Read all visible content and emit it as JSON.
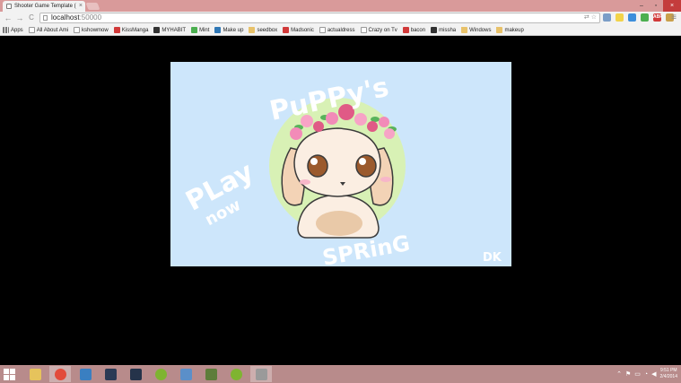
{
  "browser": {
    "tab_title": "Shooter Game Template (",
    "tab_close": "×",
    "url_host": "localhost",
    "url_port": ":50000",
    "back_glyph": "←",
    "forward_glyph": "→",
    "reload_glyph": "C",
    "star_glyph": "☆",
    "menu_glyph": "≡",
    "window_minimize": "–",
    "window_maximize": "▫",
    "window_close": "×",
    "extensions": [
      {
        "name": "translate-icon",
        "color": "#7a9dc7",
        "label": ""
      },
      {
        "name": "notes-extension-icon",
        "color": "#f2d34a",
        "label": ""
      },
      {
        "name": "skype-extension-icon",
        "color": "#3d8edb",
        "label": ""
      },
      {
        "name": "evernote-extension-icon",
        "color": "#4caf50",
        "label": ""
      },
      {
        "name": "adblock-extension-icon",
        "color": "#d13a3a",
        "label": "ABP"
      },
      {
        "name": "cookie-extension-icon",
        "color": "#c9a04b",
        "label": ""
      }
    ]
  },
  "bookmarks": [
    {
      "label": "Apps",
      "icon": "apps-grid-icon",
      "type": "apps"
    },
    {
      "label": "All About Ami",
      "icon": "page-icon",
      "type": "page"
    },
    {
      "label": "kshowmow",
      "icon": "page-icon",
      "type": "page"
    },
    {
      "label": "KissManga",
      "icon": "manga-icon",
      "type": "red"
    },
    {
      "label": "MYHABIT",
      "icon": "myhabit-icon",
      "type": "dark"
    },
    {
      "label": "Mint",
      "icon": "mint-leaf-icon",
      "type": "green"
    },
    {
      "label": "Make up",
      "icon": "wordpress-icon",
      "type": "blue"
    },
    {
      "label": "seedbox",
      "icon": "folder-icon",
      "type": "folder"
    },
    {
      "label": "Madsonic",
      "icon": "madsonic-icon",
      "type": "red"
    },
    {
      "label": "actualdress",
      "icon": "page-icon",
      "type": "page"
    },
    {
      "label": "Crazy on Tv",
      "icon": "page-icon",
      "type": "page"
    },
    {
      "label": "bacon",
      "icon": "bacon-icon",
      "type": "red"
    },
    {
      "label": "missha",
      "icon": "missha-icon",
      "type": "dark"
    },
    {
      "label": "Windows",
      "icon": "folder-icon",
      "type": "folder"
    },
    {
      "label": "makeup",
      "icon": "folder-icon",
      "type": "folder"
    }
  ],
  "game": {
    "title_top": "PuPPy's",
    "title_bottom": "SPRinG",
    "play_line1": "PLay",
    "play_line2": "now",
    "signature": "DK",
    "colors": {
      "background": "#cde6fb",
      "circle": "#d8f1b5",
      "ears": "#f3d3b6",
      "face": "#fbeee2",
      "eyes": "#9b5a2d",
      "flowers_pink": "#f28bb8",
      "flowers_red": "#e05a86",
      "leaves": "#58b35b"
    }
  },
  "taskbar": {
    "icons": [
      {
        "name": "file-explorer-icon",
        "color": "#e6c35c",
        "active": false
      },
      {
        "name": "chrome-icon",
        "color": "#e24b3b",
        "active": true
      },
      {
        "name": "app-x-icon",
        "color": "#3a7fc1",
        "active": false
      },
      {
        "name": "league-of-legends-icon",
        "color": "#2b3a55",
        "active": false
      },
      {
        "name": "steam-icon",
        "color": "#25334a",
        "active": false
      },
      {
        "name": "spotify-icon",
        "color": "#7fb431",
        "active": false
      },
      {
        "name": "network-app-icon",
        "color": "#5b8fc9",
        "active": false
      },
      {
        "name": "minecraft-icon",
        "color": "#5e7d3a",
        "active": false
      },
      {
        "name": "spotify-icon-2",
        "color": "#7fb431",
        "active": false
      },
      {
        "name": "settings-app-icon",
        "color": "#9a9a9a",
        "active": true
      }
    ],
    "time": "9:51 PM",
    "date": "2/4/2014"
  }
}
